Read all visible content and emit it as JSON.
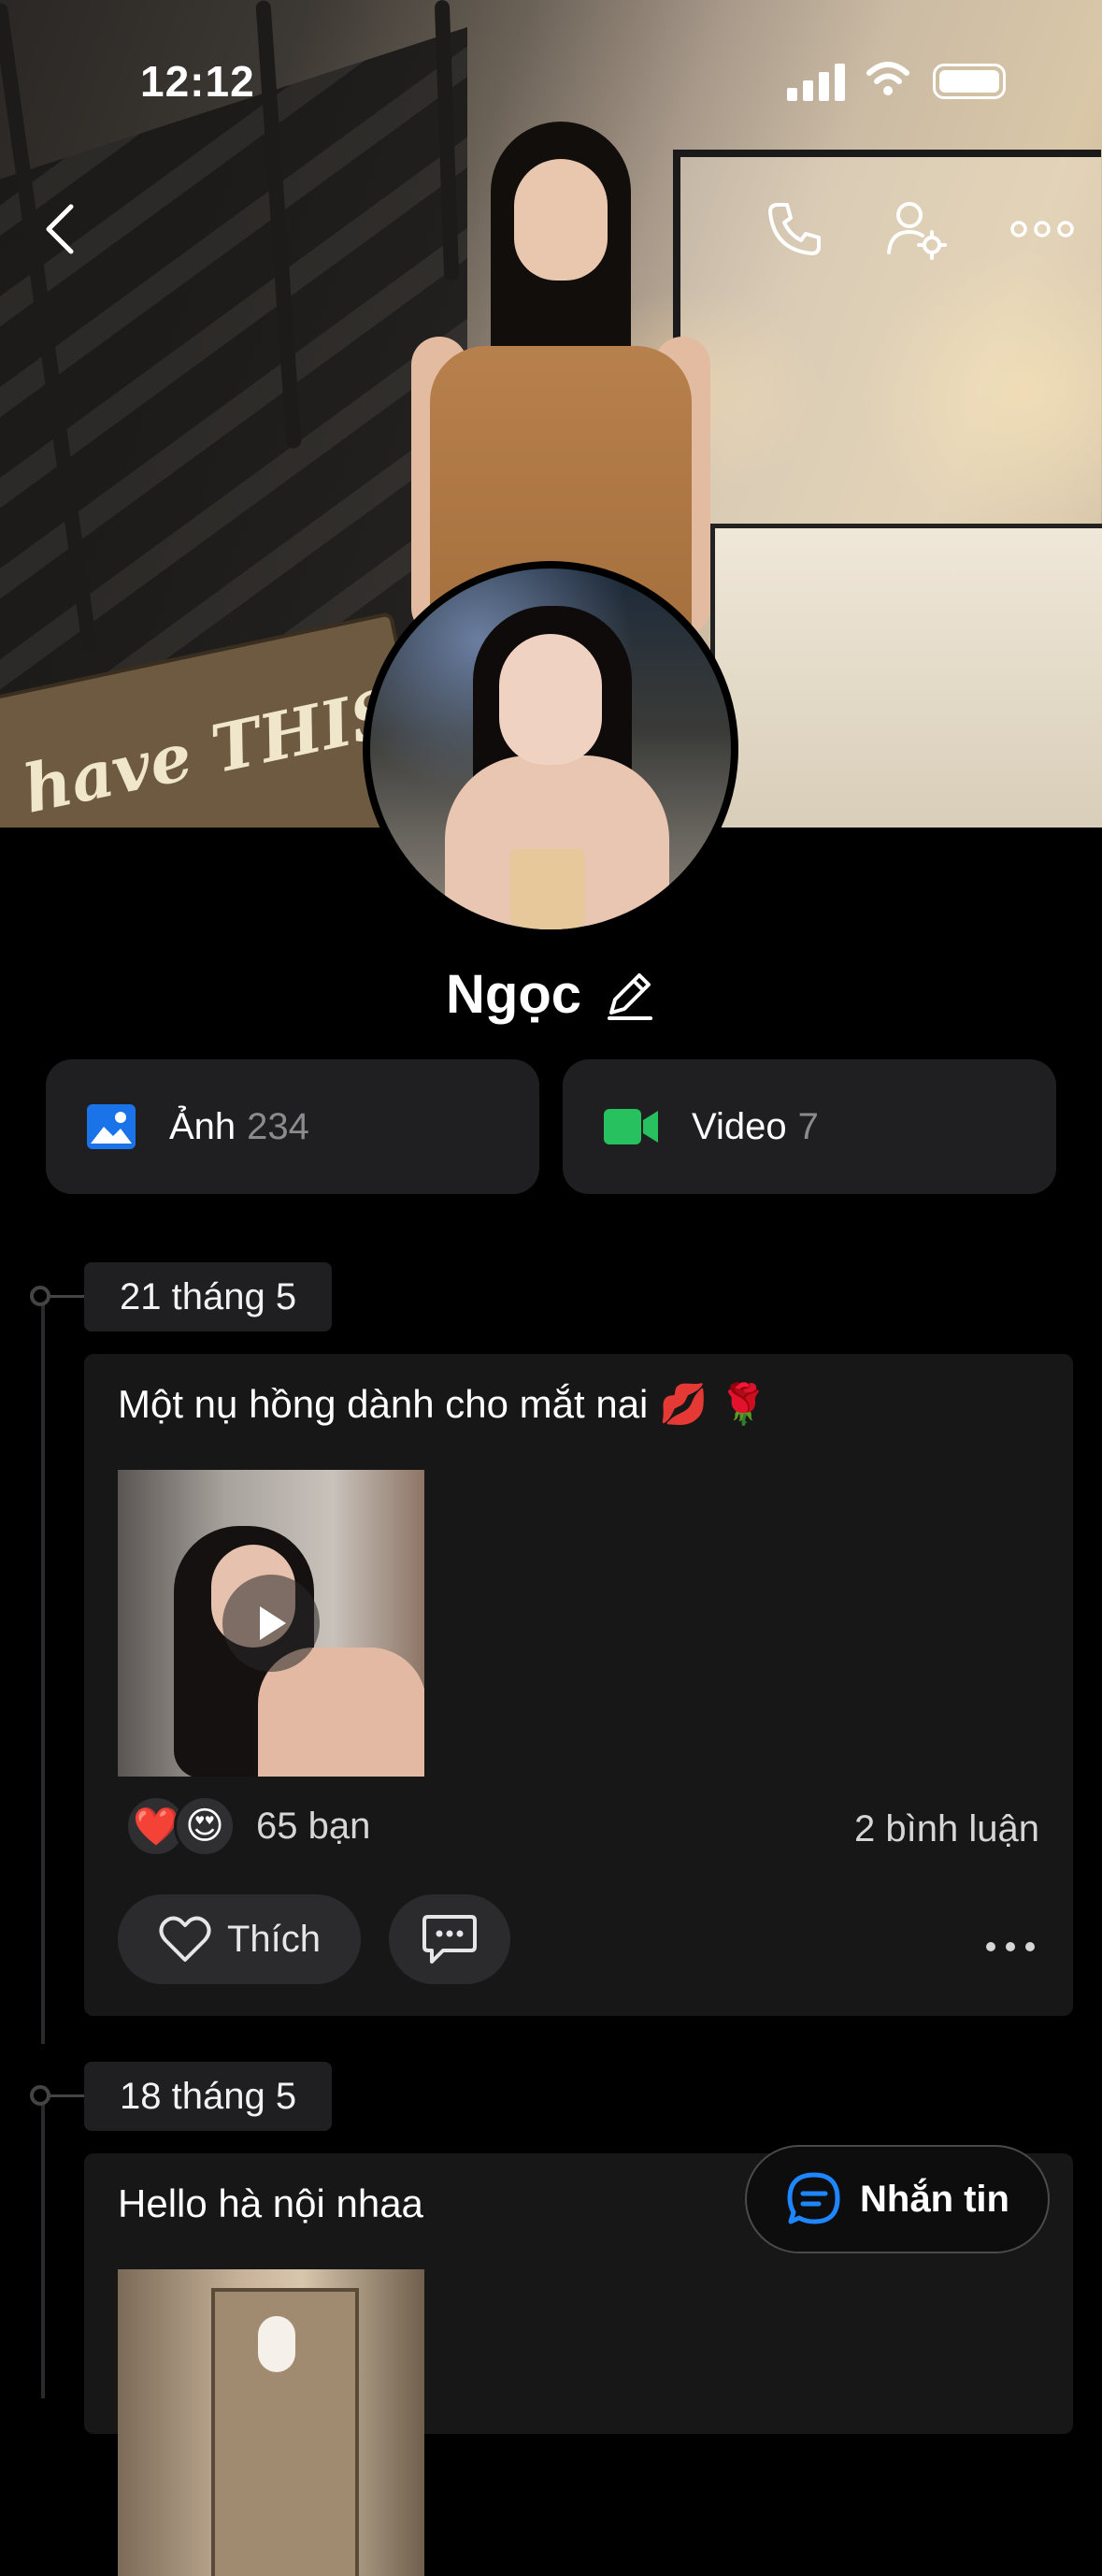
{
  "status_bar": {
    "time": "12:12"
  },
  "profile": {
    "name": "Ngọc",
    "photos": {
      "label": "Ảnh",
      "count": "234"
    },
    "videos": {
      "label": "Video",
      "count": "7"
    }
  },
  "posts": [
    {
      "date": "21 tháng 5",
      "text": "Một nụ hồng dành cho mắt nai 💋 🌹",
      "reactions": [
        "❤️",
        "😍"
      ],
      "reaction_count": "65 bạn",
      "comments": "2 bình luận",
      "like_label": "Thích"
    },
    {
      "date": "18 tháng 5",
      "text": "Hello hà nội nhaa"
    }
  ],
  "message_button": {
    "label": "Nhắn tin"
  },
  "colors": {
    "photo_icon": "#1a73e8",
    "video_icon": "#27c25f",
    "accent_blue": "#1e86ff"
  }
}
